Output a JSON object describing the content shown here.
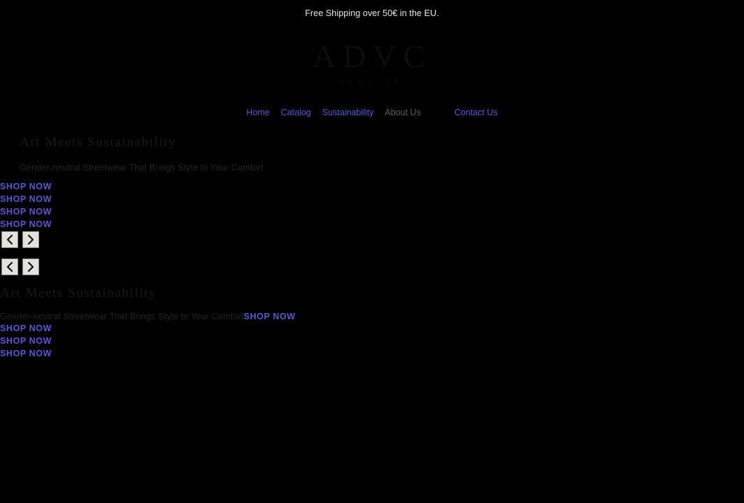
{
  "announcement": {
    "text": "Free Shipping over 50€ in the EU."
  },
  "brand": {
    "mark": "ADVC",
    "tagline": "ATELIER"
  },
  "nav": {
    "items": [
      {
        "label": "Home",
        "style": "link"
      },
      {
        "label": "Catalog",
        "style": "link"
      },
      {
        "label": "Sustainability",
        "style": "link"
      },
      {
        "label": "About Us",
        "style": "muted"
      },
      {
        "label": "Contact Us",
        "style": "link"
      }
    ]
  },
  "hero": {
    "heading": "Art Meets Sustainability",
    "subheading": "Gender-neutral Streetwear That Brings Style to Your Comfort",
    "cta_label": "SHOP NOW",
    "cta_repeat_top": [
      "SHOP NOW",
      "SHOP NOW",
      "SHOP NOW",
      "SHOP NOW"
    ],
    "cta_repeat_bottom": [
      "SHOP NOW",
      "SHOP NOW",
      "SHOP NOW"
    ]
  },
  "carousel": {
    "prev_label": "‹",
    "next_label": "›",
    "groups": 2
  },
  "colors": {
    "background": "#000000",
    "link": "#5a56d6",
    "muted_link": "#5e5e5e",
    "announcement_text": "#e8e8e8",
    "heading_text": "#1a1a1a",
    "button_face": "#e2e2dc"
  }
}
